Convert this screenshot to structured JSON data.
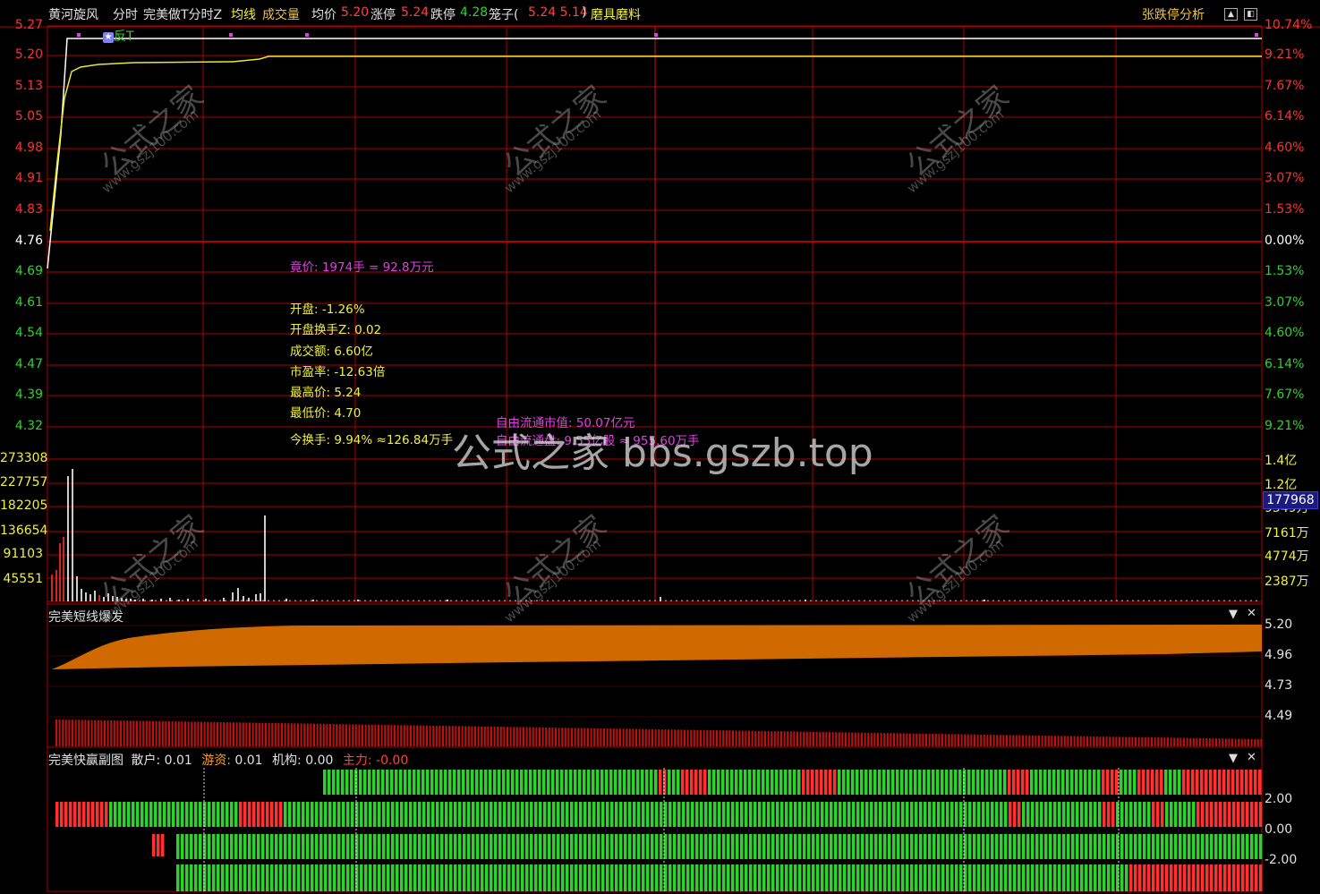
{
  "header": {
    "stock_name": "黄河旋风",
    "tab_intraday": "分时",
    "indicator": "完美做T分时Z",
    "avg_line_label": "均线",
    "volume_label": "成交量",
    "avg_price_label": "均价",
    "avg_price_value": "5.20",
    "limit_up_label": "涨停",
    "limit_up_value": "5.24",
    "limit_down_label": "跌停",
    "limit_down_value": "4.28",
    "cage_label": "笼子(",
    "cage_value": "5.24  5.14",
    "cage_close": ")",
    "sector": "磨具磨料",
    "analysis_button": "张跌停分析"
  },
  "price_axis_left": [
    "5.27",
    "5.20",
    "5.13",
    "5.05",
    "4.98",
    "4.91",
    "4.83",
    "4.76",
    "4.69",
    "4.61",
    "4.54",
    "4.47",
    "4.39",
    "4.32"
  ],
  "price_axis_right": [
    "10.74%",
    "9.21%",
    "7.67%",
    "6.14%",
    "4.60%",
    "3.07%",
    "1.53%",
    "0.00%",
    "1.53%",
    "3.07%",
    "4.60%",
    "6.14%",
    "7.67%",
    "9.21%"
  ],
  "volume_axis_left": [
    "273308",
    "227757",
    "182205",
    "136654",
    "91103",
    "45551"
  ],
  "volume_axis_right": [
    "1.4亿",
    "1.2亿",
    "9549万",
    "7161万",
    "4774万",
    "2387万"
  ],
  "volume_tooltip": "177968",
  "marker_label": "反T",
  "info_panel": {
    "auction": "竟价: 1974手 = 92.8万元",
    "open": "开盘: -1.26%",
    "open_turnover": "开盘换手Z: 0.02",
    "amount": "成交额: 6.60亿",
    "pe": "市盈率: -12.63倍",
    "high": "最高价: 5.24",
    "low": "最低价: 4.70",
    "turnover": "今换手: 9.94% ≈126.84万手",
    "free_float_value": "自由流通市值: 50.07亿元",
    "free_float_shares": "自由流通盘: 9.55亿股 ≈ 955.60万手"
  },
  "panel2": {
    "title": "完美短线爆发",
    "axis": [
      "5.20",
      "4.96",
      "4.73",
      "4.49"
    ]
  },
  "panel3": {
    "title": "完美快赢副图",
    "retail_label": "散户:",
    "retail_value": "0.01",
    "hot_label": "游资:",
    "hot_value": "0.01",
    "inst_label": "机构:",
    "inst_value": "0.00",
    "main_label": "主力:",
    "main_value": "-0.00",
    "axis": [
      "2.00",
      "0.00",
      "-2.00"
    ]
  },
  "watermarks": {
    "big": "公式之家 bbs.gszb.top",
    "site_cn": "公式之家",
    "site_url": "www.gszj100.com"
  },
  "colors": {
    "grid": "#b00000",
    "price_line": "#ffffff",
    "avg_line": "#e8e830",
    "up": "#ff3030",
    "down": "#30d030",
    "orange_fill": "#d06a00",
    "magenta": "#e040e0",
    "yellow": "#f0f040"
  }
}
